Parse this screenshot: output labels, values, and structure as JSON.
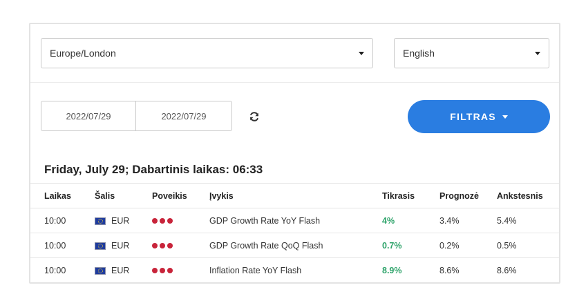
{
  "filters": {
    "timezone": "Europe/London",
    "language": "English",
    "date_from": "2022/07/29",
    "date_to": "2022/07/29",
    "filter_button": "FILTRAS"
  },
  "heading": "Friday, July 29; Dabartinis laikas: 06:33",
  "columns": {
    "time": "Laikas",
    "country": "Šalis",
    "impact": "Poveikis",
    "event": "Įvykis",
    "actual": "Tikrasis",
    "forecast": "Prognozė",
    "previous": "Ankstesnis"
  },
  "rows": [
    {
      "time": "10:00",
      "currency": "EUR",
      "impact_level": 3,
      "event": "GDP Growth Rate YoY Flash",
      "actual": "4%",
      "forecast": "3.4%",
      "previous": "5.4%"
    },
    {
      "time": "10:00",
      "currency": "EUR",
      "impact_level": 3,
      "event": "GDP Growth Rate QoQ Flash",
      "actual": "0.7%",
      "forecast": "0.2%",
      "previous": "0.5%"
    },
    {
      "time": "10:00",
      "currency": "EUR",
      "impact_level": 3,
      "event": "Inflation Rate YoY Flash",
      "actual": "8.9%",
      "forecast": "8.6%",
      "previous": "8.6%"
    }
  ],
  "colors": {
    "accent": "#2a7de1",
    "impact_dot": "#c8243a",
    "actual_positive": "#2ea36a"
  },
  "icons": {
    "refresh": "refresh-icon",
    "flag": "eu-flag-icon"
  }
}
